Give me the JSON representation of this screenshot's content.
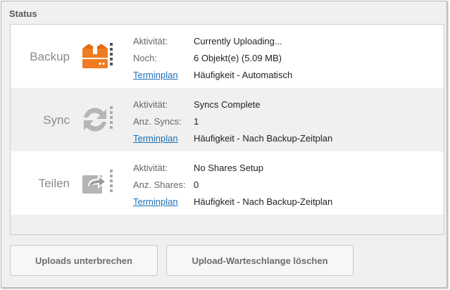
{
  "section_title": "Status",
  "rows": [
    {
      "name": "Backup",
      "icon": "backup-upload-icon",
      "activity_label": "Aktivität:",
      "activity_value": "Currently Uploading...",
      "second_label": "Noch:",
      "second_value": "6 Objekt(e) (5.09 MB)",
      "schedule_link": "Terminplan",
      "schedule_value": "Häufigkeit - Automatisch"
    },
    {
      "name": "Sync",
      "icon": "sync-icon",
      "activity_label": "Aktivität:",
      "activity_value": "Syncs Complete",
      "second_label": "Anz. Syncs:",
      "second_value": "1",
      "schedule_link": "Terminplan",
      "schedule_value": "Häufigkeit - Nach Backup-Zeitplan"
    },
    {
      "name": "Teilen",
      "icon": "share-icon",
      "activity_label": "Aktivität:",
      "activity_value": "No Shares Setup",
      "second_label": "Anz. Shares:",
      "second_value": "0",
      "schedule_link": "Terminplan",
      "schedule_value": "Häufigkeit - Nach Backup-Zeitplan"
    }
  ],
  "buttons": {
    "pause_uploads": "Uploads unterbrechen",
    "clear_queue": "Upload-Warteschlange löschen"
  },
  "colors": {
    "backup_accent": "#f07b22",
    "link": "#1a6fb5",
    "inactive_icon": "#b5b5b5"
  }
}
